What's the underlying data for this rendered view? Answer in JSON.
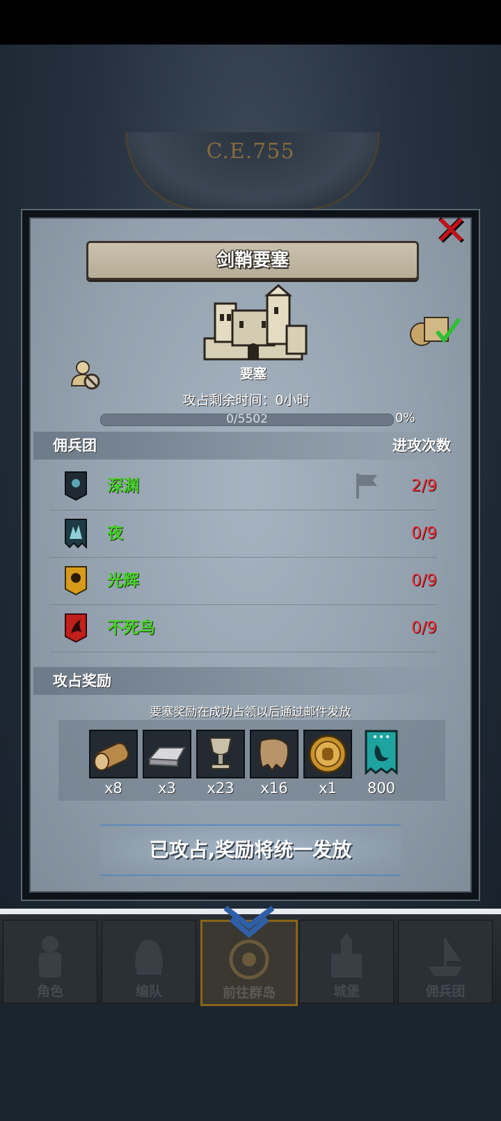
{
  "background": {
    "year": "C.E.755"
  },
  "modal": {
    "title": "剑鞘要塞",
    "building_label": "要塞",
    "remaining_time": "攻占剩余时间：0小时",
    "progress": {
      "text": "0/5502",
      "percent_label": "0%",
      "fraction": 0
    },
    "mercenary_header": "佣兵团",
    "attack_header": "进攻次数",
    "teams": [
      {
        "name": "深渊",
        "count": "2/9",
        "banner_color": "#1f2a33"
      },
      {
        "name": "夜",
        "count": "0/9",
        "banner_color": "#1d3b44"
      },
      {
        "name": "光辉",
        "count": "0/9",
        "banner_color": "#d89a1a"
      },
      {
        "name": "不死鸟",
        "count": "0/9",
        "banner_color": "#c2201c"
      }
    ],
    "reward_header": "攻占奖励",
    "reward_note": "要塞奖励在成功占领以后通过邮件发放",
    "rewards": [
      {
        "icon": "wood-log-icon",
        "qty": "x8"
      },
      {
        "icon": "iron-ingot-icon",
        "qty": "x3"
      },
      {
        "icon": "goblet-icon",
        "qty": "x23"
      },
      {
        "icon": "fur-pelt-icon",
        "qty": "x16"
      },
      {
        "icon": "gold-medal-icon",
        "qty": "x1"
      },
      {
        "icon": "teal-banner-icon",
        "qty": "800"
      }
    ],
    "bottom_button": "已攻占,奖励将统一发放"
  },
  "nav": {
    "items": [
      {
        "label": "角色"
      },
      {
        "label": "编队"
      },
      {
        "label": "前往群岛",
        "active": true
      },
      {
        "label": "城堡"
      },
      {
        "label": "佣兵团"
      }
    ]
  }
}
